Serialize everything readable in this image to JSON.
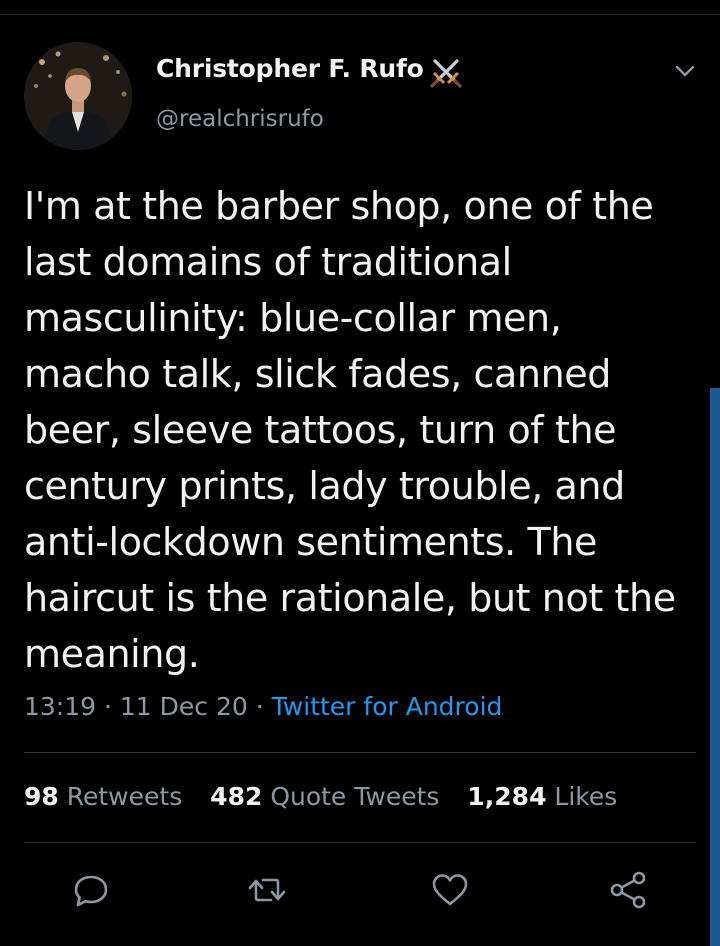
{
  "tweet": {
    "author": {
      "name": "Christopher F. Rufo",
      "handle": "@realchrisrufo",
      "badge_icon": "crossed-swords-icon"
    },
    "text": "I'm at the barber shop, one of the last domains of traditional masculinity: blue-collar men, macho talk, slick fades, canned beer, sleeve tattoos, turn of the century prints, lady trouble, and anti-lockdown sentiments. The haircut is the rationale, but not the meaning.",
    "time": "13:19",
    "separator": "·",
    "date": "11 Dec 20",
    "source": "Twitter for Android"
  },
  "stats": {
    "retweets": {
      "count": "98",
      "label": "Retweets"
    },
    "quote_tweets": {
      "count": "482",
      "label": "Quote Tweets"
    },
    "likes": {
      "count": "1,284",
      "label": "Likes"
    }
  },
  "actions": [
    "reply-icon",
    "retweet-icon",
    "like-icon",
    "share-icon"
  ],
  "colors": {
    "background": "#000000",
    "text": "#f2f2f2",
    "muted": "#8b98a5",
    "link": "#1d9bf0",
    "divider": "#2b2f33",
    "scrollbar": "#1d5a92"
  }
}
